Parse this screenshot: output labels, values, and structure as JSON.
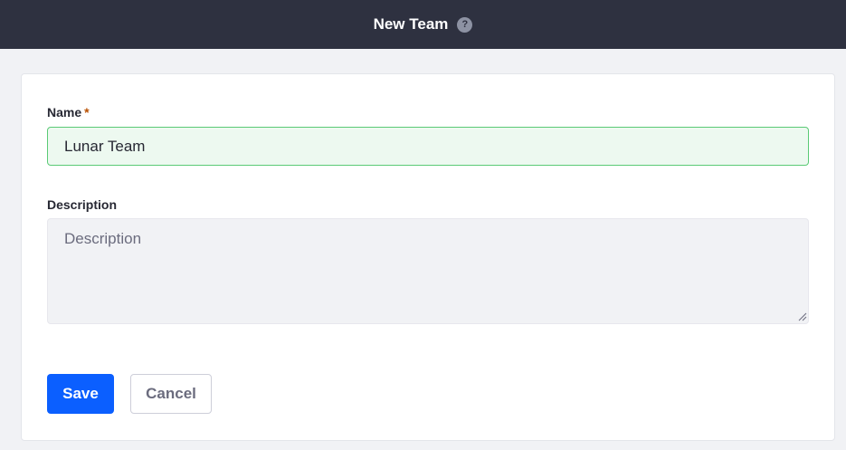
{
  "header": {
    "title": "New Team",
    "help_icon": "question-circle-icon",
    "help_glyph": "?"
  },
  "form": {
    "name": {
      "label": "Name",
      "required_marker": "*",
      "value": "Lunar Team"
    },
    "description": {
      "label": "Description",
      "placeholder": "Description",
      "value": ""
    }
  },
  "actions": {
    "save_label": "Save",
    "cancel_label": "Cancel"
  },
  "colors": {
    "header_bg": "#2e3140",
    "primary": "#0b5fff",
    "valid_border": "#5aca75",
    "valid_bg": "#edf9f0",
    "required": "#b95000"
  }
}
